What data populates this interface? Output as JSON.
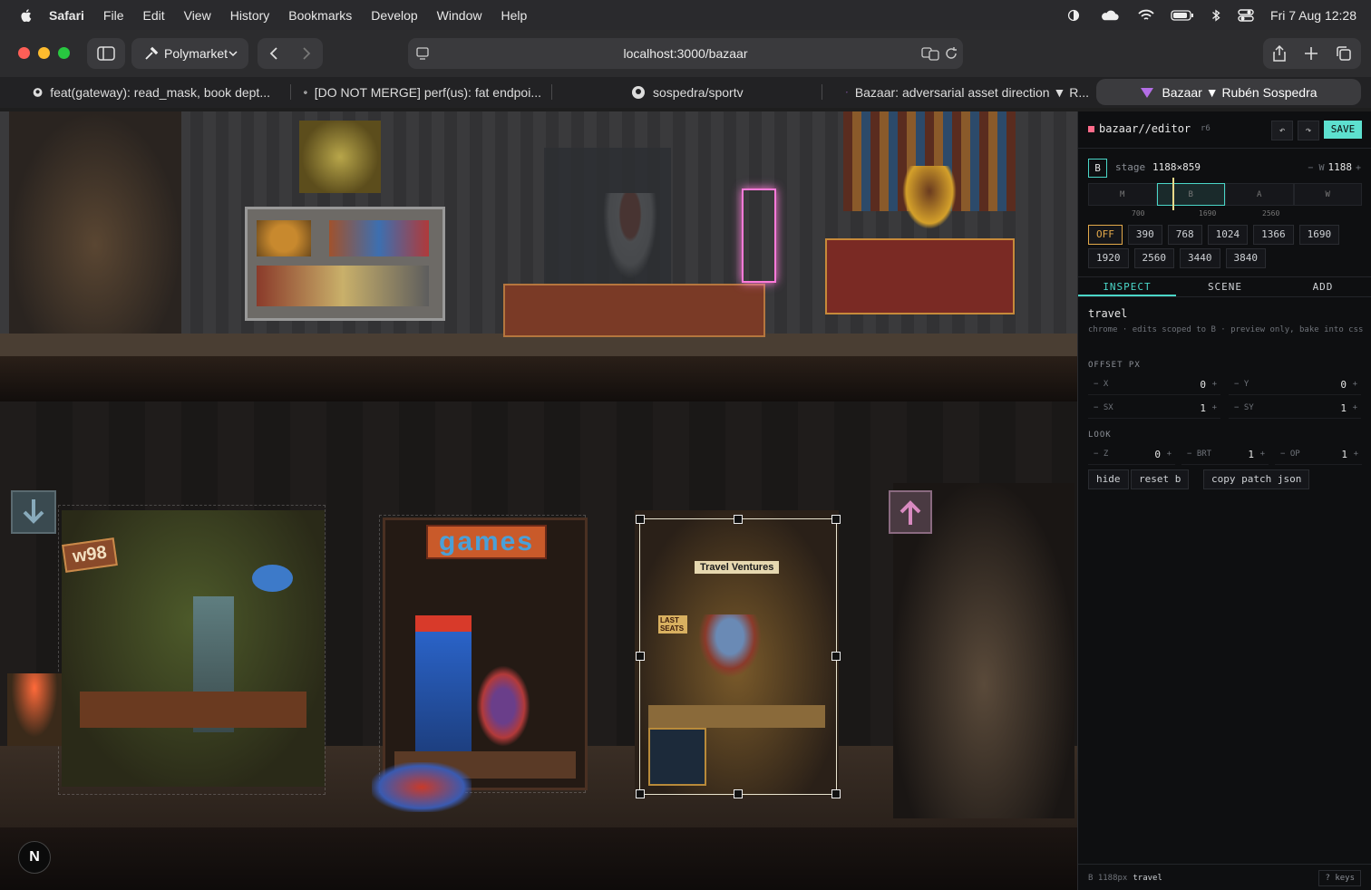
{
  "menubar": {
    "app": "Safari",
    "items": [
      "File",
      "Edit",
      "View",
      "History",
      "Bookmarks",
      "Develop",
      "Window",
      "Help"
    ],
    "clock": "Fri 7 Aug  12:28"
  },
  "toolbar": {
    "profile": "Polymarket",
    "url": "localhost:3000/bazaar"
  },
  "tabs": [
    {
      "label": "feat(gateway): read_mask, book dept...",
      "icon": "github-icon"
    },
    {
      "label": "[DO NOT MERGE] perf(us): fat endpoi...",
      "icon": "github-icon"
    },
    {
      "label": "sospedra/sportv",
      "icon": "github-icon"
    },
    {
      "label": "Bazaar: adversarial asset direction ▼ R...",
      "icon": "bazaar-icon"
    },
    {
      "label": "Bazaar ▼ Rubén Sospedra",
      "icon": "bazaar-icon",
      "active": true
    }
  ],
  "stage": {
    "signs": {
      "w98": "w98",
      "games": "games",
      "travel": "Travel Ventures",
      "last_seats": "LAST SEATS"
    },
    "n_button": "N"
  },
  "editor": {
    "title": "bazaar//editor",
    "version": "r6",
    "undo": "↶",
    "redo": "↷",
    "save": "SAVE",
    "breakpoint_letter": "B",
    "stage_label": "stage",
    "stage_size": "1188×859",
    "width_minus": "− W",
    "width_value": "1188",
    "width_plus": "+",
    "bp_segments": [
      "M",
      "B",
      "A",
      "W"
    ],
    "bp_ticks": [
      "700",
      "1690",
      "2560"
    ],
    "widths_row1": [
      "OFF",
      "390",
      "768",
      "1024",
      "1366",
      "1690"
    ],
    "widths_row2": [
      "1920",
      "2560",
      "3440",
      "3840"
    ],
    "tabs": [
      "INSPECT",
      "SCENE",
      "ADD"
    ],
    "element_name": "travel",
    "element_desc": "chrome · edits scoped to B · preview only, bake into css",
    "offset_section": "OFFSET PX",
    "offset_fields": [
      {
        "label": "− X",
        "value": "0"
      },
      {
        "label": "− Y",
        "value": "0"
      },
      {
        "label": "− SX",
        "value": "1"
      },
      {
        "label": "− SY",
        "value": "1"
      }
    ],
    "look_section": "LOOK",
    "look_fields": [
      {
        "label": "− Z",
        "value": "0"
      },
      {
        "label": "− BRT",
        "value": "1"
      },
      {
        "label": "− OP",
        "value": "1"
      }
    ],
    "actions": [
      "hide",
      "reset b",
      "copy patch json"
    ],
    "footer_left": "B 1188px",
    "footer_sel": "travel",
    "footer_keys": "? keys"
  },
  "colors": {
    "accent": "#5de0cf",
    "warning": "#e3a94a",
    "selection": "#e8e4d0"
  }
}
